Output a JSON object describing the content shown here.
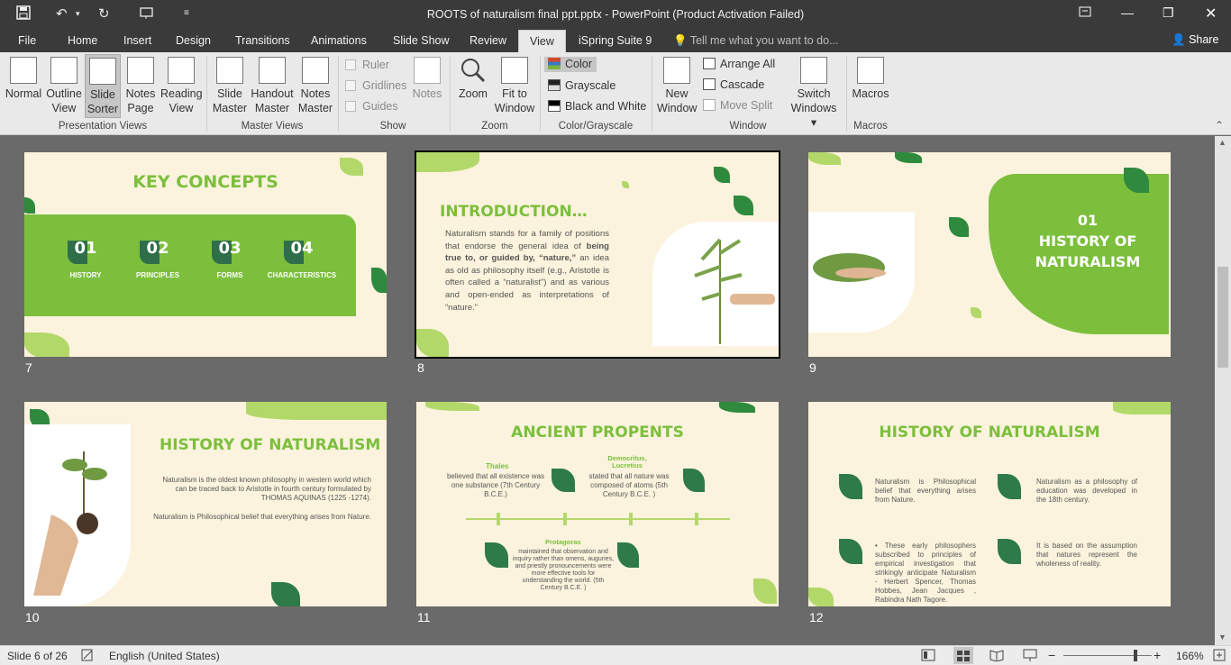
{
  "window": {
    "title": "ROOTS of naturalism final ppt.pptx - PowerPoint (Product Activation Failed)"
  },
  "tabs": [
    "File",
    "Home",
    "Insert",
    "Design",
    "Transitions",
    "Animations",
    "Slide Show",
    "Review",
    "View",
    "iSpring Suite 9"
  ],
  "tell_me": "Tell me what you want to do...",
  "share": "Share",
  "ribbon": {
    "normal": "Normal",
    "outline": "Outline",
    "outline2": "View",
    "sorter": "Slide",
    "sorter2": "Sorter",
    "notes": "Notes",
    "notes2": "Page",
    "reading": "Reading",
    "reading2": "View",
    "grp_pv": "Presentation Views",
    "sm": "Slide",
    "sm2": "Master",
    "hm": "Handout",
    "hm2": "Master",
    "nm": "Notes",
    "nm2": "Master",
    "grp_mv": "Master Views",
    "ruler": "Ruler",
    "gridlines": "Gridlines",
    "guides": "Guides",
    "notes_btn": "Notes",
    "grp_show": "Show",
    "zoom": "Zoom",
    "fit": "Fit to",
    "fit2": "Window",
    "grp_zoom": "Zoom",
    "color": "Color",
    "grayscale": "Grayscale",
    "bw": "Black and White",
    "grp_color": "Color/Grayscale",
    "new_window": "New",
    "new_window2": "Window",
    "arrange": "Arrange All",
    "cascade": "Cascade",
    "move_split": "Move Split",
    "switch": "Switch",
    "switch2": "Windows",
    "grp_window": "Window",
    "macros": "Macros",
    "grp_macros": "Macros"
  },
  "slides": {
    "s7": {
      "num": "7",
      "title": "KEY CONCEPTS",
      "items": [
        {
          "n": "01",
          "l": "HISTORY"
        },
        {
          "n": "02",
          "l": "PRINCIPLES"
        },
        {
          "n": "03",
          "l": "FORMS"
        },
        {
          "n": "04",
          "l": "CHARACTERISTICS"
        }
      ]
    },
    "s8": {
      "num": "8",
      "title": "INTRODUCTION…",
      "p1": "Naturalism stands for a family of positions that endorse the general idea of ",
      "bold": "being true to, or guided by, “nature,”",
      "p2": " an idea as old as philosophy itself (e.g., Aristotle is often called a “naturalist”) and as various and open-ended as interpretations of “nature.”"
    },
    "s9": {
      "num": "9",
      "l1": "01",
      "l2": "HISTORY OF",
      "l3": "NATURALISM"
    },
    "s10": {
      "num": "10",
      "title": "HISTORY OF NATURALISM",
      "p1": "Naturalism is the oldest known philosophy in western world which can be traced back to Aristotle in fourth century formulated by THOMAS AQUINAS (1225 -1274).",
      "p2": "Naturalism is Philosophical belief that everything arises from Nature."
    },
    "s11": {
      "num": "11",
      "title": "ANCIENT PROPENTS",
      "thales": "Thales",
      "thales_t": "believed that all existence was one substance (7th Century B.C.E.)",
      "dem": "Democritus, Lucretius",
      "dem_t": "stated that all nature was composed of atoms (5th Century B.C.E. )",
      "prot": "Protagoras",
      "prot_t": "maintained that observation and inquiry rather than omens, auguries, and priestly pronouncements were more effective tools for understanding the world. (5th Century B.C.E. )"
    },
    "s12": {
      "num": "12",
      "title": "HISTORY OF NATURALISM",
      "c1": "Naturalism is Philosophical belief that everything arises from Nature.",
      "c2": "Naturalism as a philosophy of education was developed in the 18th century.",
      "c3": "• These early philosophers subscribed to principles of empirical investigation that strikingly anticipate Naturalism - Herbert Spencer, Thomas Hobbes, Jean Jacques , Rabindra Nath Tagore.",
      "c4": "It is based on the assumption that natures represent the wholeness of reality."
    }
  },
  "status": {
    "slide": "Slide 6 of 26",
    "language": "English (United States)",
    "zoom": "166%"
  }
}
